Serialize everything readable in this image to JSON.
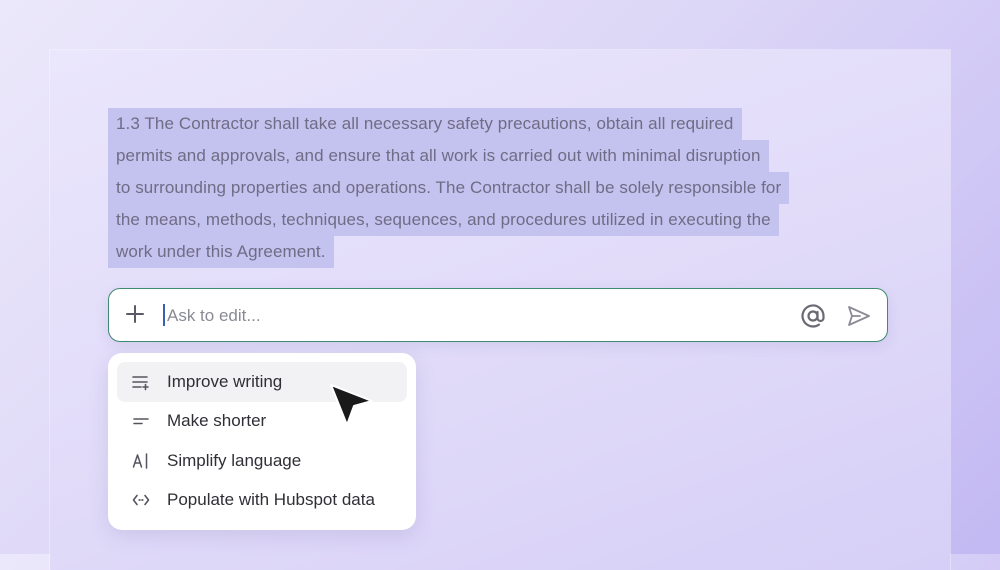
{
  "document": {
    "paragraph_lines": [
      "1.3 The Contractor shall take all necessary safety precautions, obtain all required",
      "permits and approvals, and ensure that all work is carried out with minimal disruption",
      "to surrounding properties and operations. The Contractor shall be solely responsible for",
      "the means, methods, techniques, sequences, and procedures utilized in executing the",
      "work under this Agreement."
    ]
  },
  "ask_bar": {
    "placeholder": "Ask to edit...",
    "value": "",
    "icons": [
      "plus-icon",
      "at-icon",
      "send-icon"
    ]
  },
  "menu": {
    "items": [
      {
        "label": "Improve writing",
        "icon": "improve-writing-icon",
        "highlighted": true
      },
      {
        "label": "Make shorter",
        "icon": "make-shorter-icon",
        "highlighted": false
      },
      {
        "label": "Simplify language",
        "icon": "simplify-language-icon",
        "highlighted": false
      },
      {
        "label": "Populate with Hubspot data",
        "icon": "code-icon",
        "highlighted": false
      }
    ]
  },
  "colors": {
    "selection": "#c4c2ee",
    "ask_border": "#3e8a72",
    "caret": "#3a5fb0"
  }
}
